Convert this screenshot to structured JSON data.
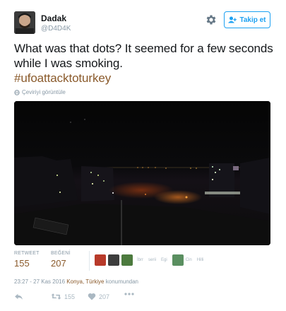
{
  "user": {
    "display_name": "Dadak",
    "username": "@D4D4K",
    "avatar_icon": "user-avatar"
  },
  "header": {
    "settings_icon": "gear-icon",
    "follow_label": "Takip et"
  },
  "tweet": {
    "text": "What was that dots? It seemed for a few seconds while I was smoking.",
    "hashtag": "#ufoattacktoturkey",
    "translate_label": "Çeviriyi görüntüle"
  },
  "stats": {
    "retweet_label": "RETWEET",
    "retweet_count": "155",
    "like_label": "BEĞENİ",
    "like_count": "207",
    "likers": [
      {
        "name": "",
        "color": "#b83a2a"
      },
      {
        "name": "",
        "color": "#3d3d3d"
      },
      {
        "name": "",
        "color": "#4c7a3e"
      },
      {
        "name": "İbrr",
        "color": ""
      },
      {
        "name": "serii",
        "color": ""
      },
      {
        "name": "Egi",
        "color": ""
      },
      {
        "name": "Cin",
        "color": "#5a8f60"
      },
      {
        "name": "Hilli",
        "color": ""
      }
    ]
  },
  "timestamp": {
    "time": "23:27 - 27 Kas 2016",
    "location": "Konya, Türkiye",
    "suffix": "konumundan"
  },
  "actions": {
    "reply_icon": "reply-icon",
    "retweet_icon": "retweet-icon",
    "retweet_count": "155",
    "like_icon": "heart-icon",
    "like_count": "207",
    "more_icon": "more-icon"
  },
  "colors": {
    "accent": "#1da1f2",
    "link": "#8a5a2b",
    "muted": "#8899a6"
  }
}
